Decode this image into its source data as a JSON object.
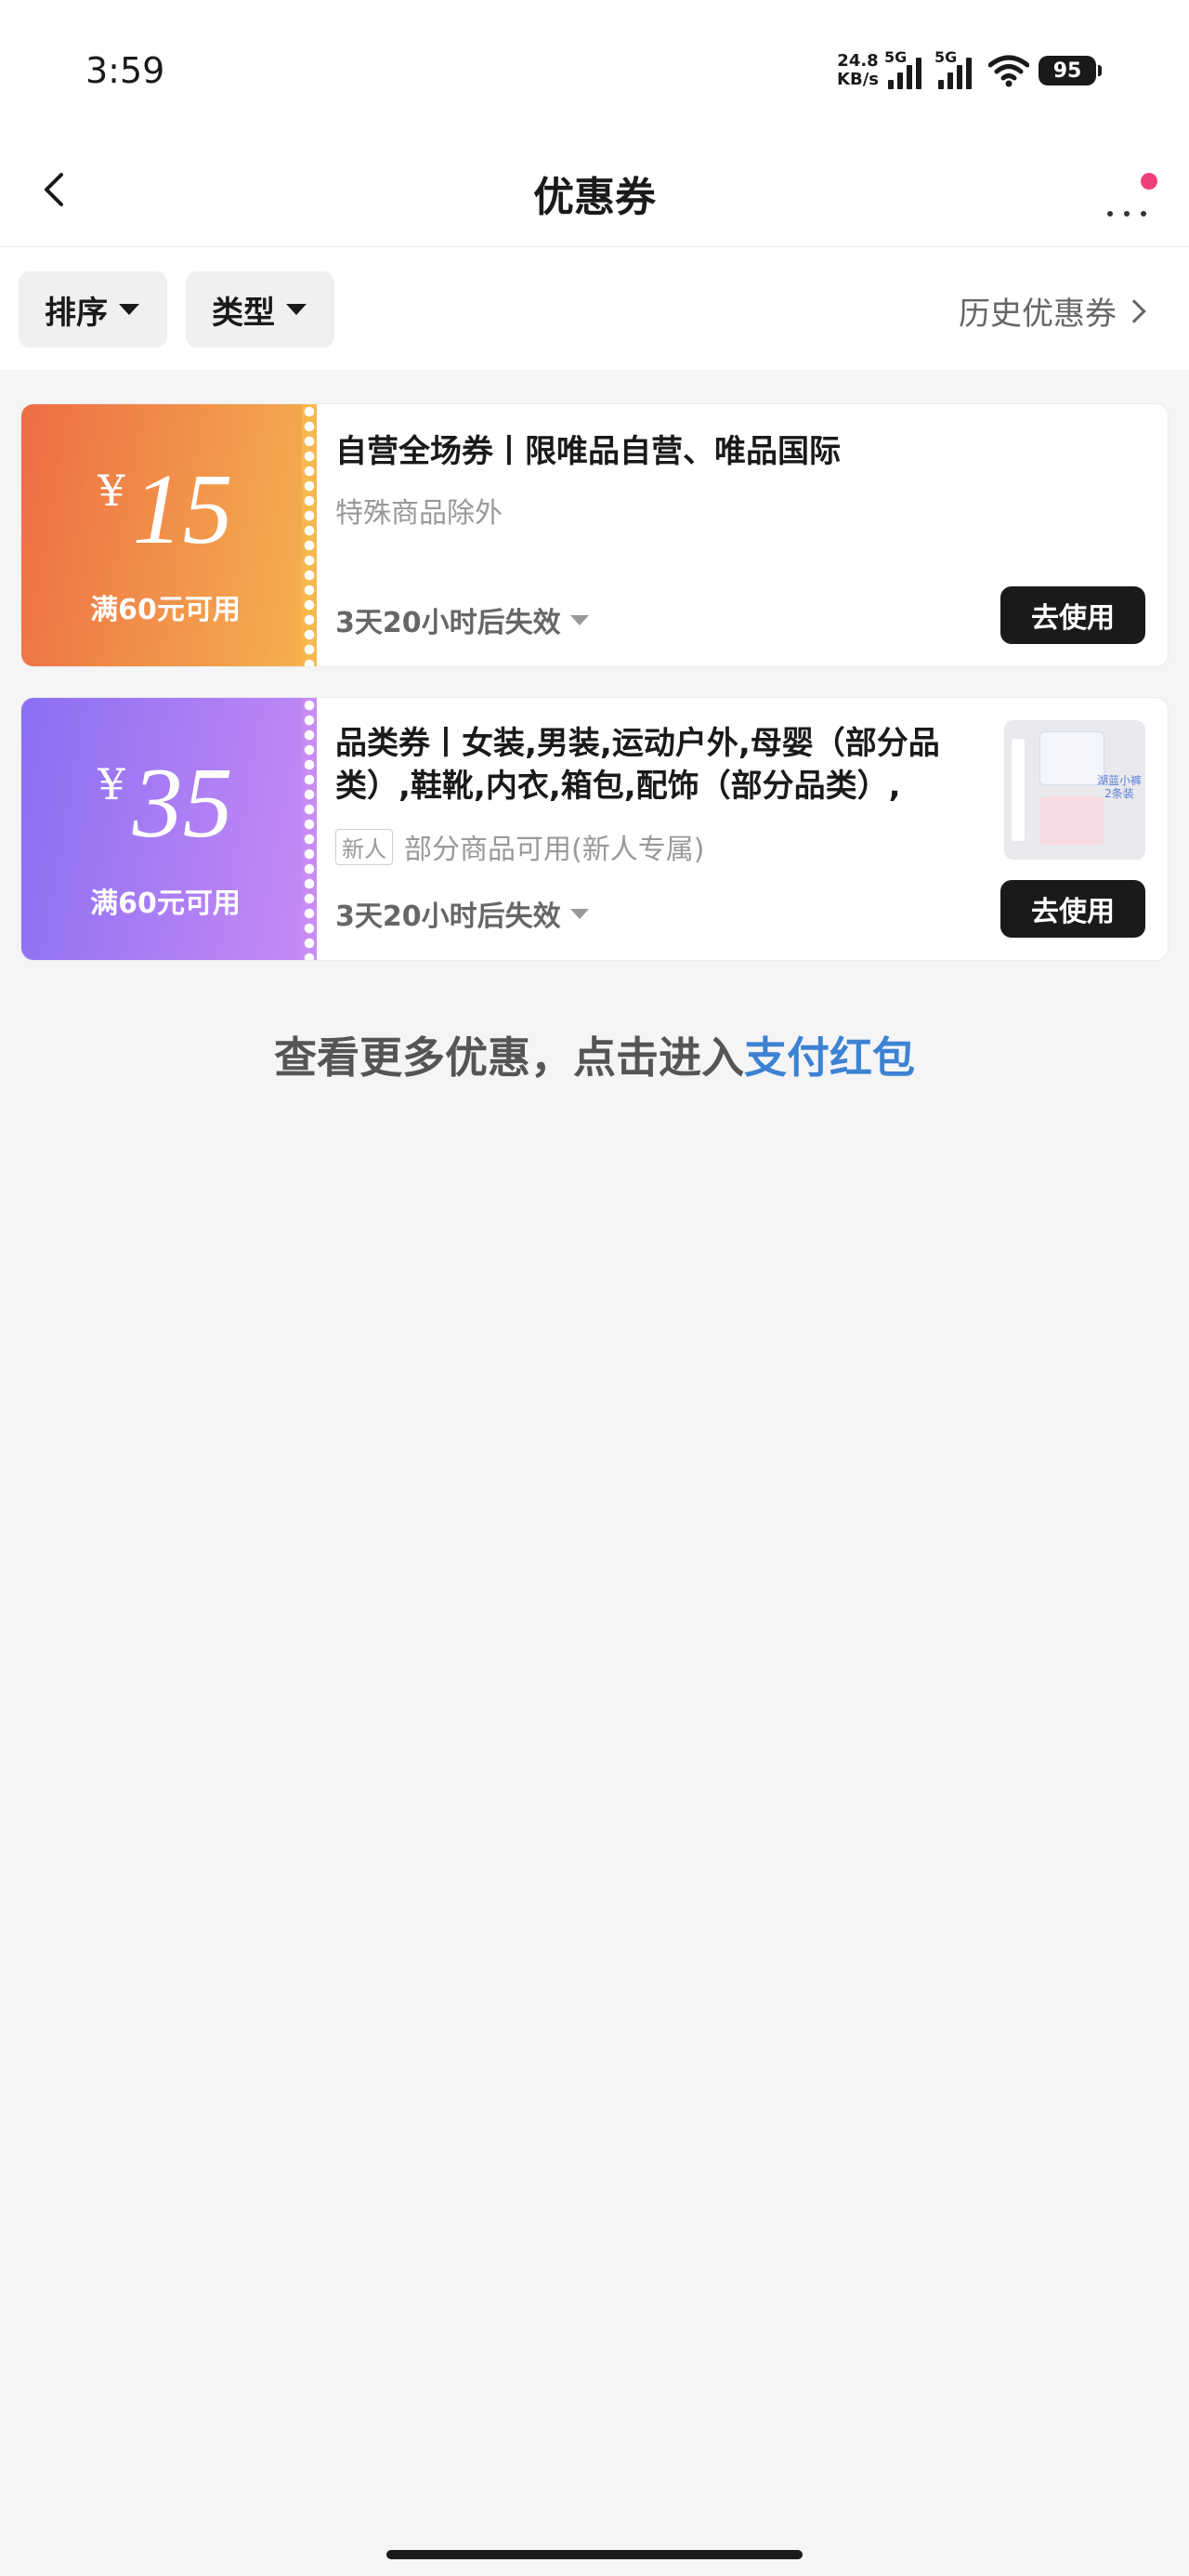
{
  "status_bar": {
    "time": "3:59",
    "net_speed_value": "24.8",
    "net_speed_unit": "KB/s",
    "signal_1_label": "5G",
    "signal_2_label": "5G",
    "battery": "95"
  },
  "nav": {
    "title": "优惠券",
    "has_notification": true
  },
  "filters": {
    "sort_label": "排序",
    "type_label": "类型",
    "history_label": "历史优惠券"
  },
  "coupons": [
    {
      "currency": "¥",
      "amount": "15",
      "min_spend": "满60元可用",
      "title": "自营全场券丨限唯品自营、唯品国际",
      "subtitle": "特殊商品除外",
      "expiry": "3天20小时后失效",
      "action": "去使用",
      "color_start": "#ed6d45",
      "color_end": "#f5b24f"
    },
    {
      "currency": "¥",
      "amount": "35",
      "min_spend": "满60元可用",
      "title": "品类券丨女装,男装,运动户外,母婴（部分品类）,鞋靴,内衣,箱包,配饰（部分品类）,钟...",
      "tag": "新人",
      "subtitle": "部分商品可用(新人专属)",
      "expiry": "3天20小时后失效",
      "action": "去使用",
      "thumb_text": "湖蓝小裤 2条装",
      "color_start": "#8a6ff3",
      "color_end": "#c78af4"
    }
  ],
  "footer": {
    "more_text": "查看更多优惠，点击进入",
    "more_link": "支付红包",
    "link_color": "#3d82d3"
  }
}
